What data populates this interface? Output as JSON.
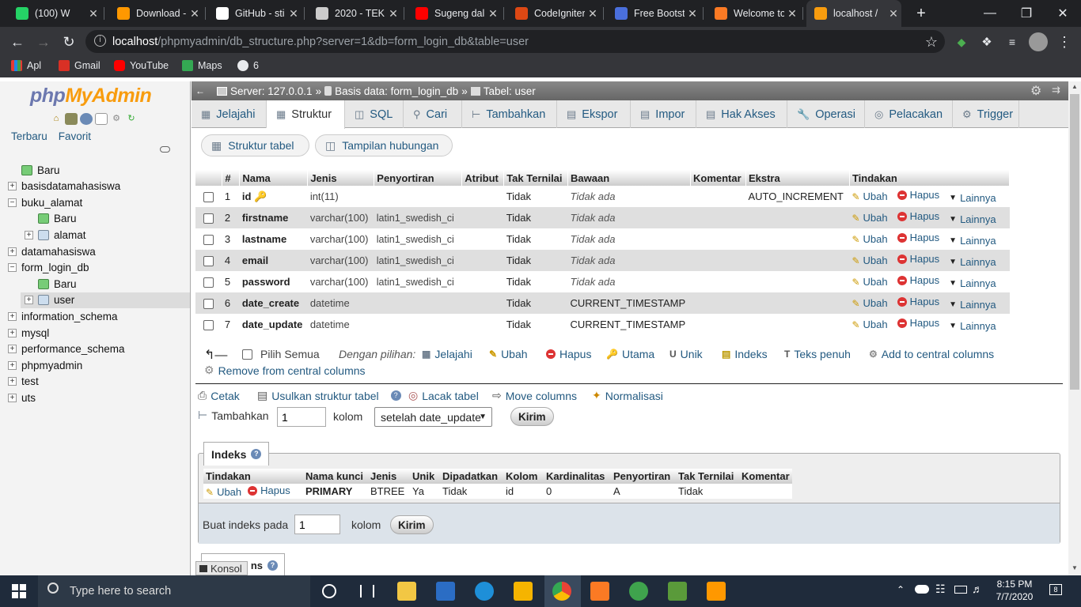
{
  "browser": {
    "tabs": [
      {
        "title": "(100) W",
        "fav": "whatsapp-icon",
        "color": "#25d366"
      },
      {
        "title": "Download -",
        "fav": "sublime-icon",
        "color": "#ff9800"
      },
      {
        "title": "GitHub - sti",
        "fav": "github-icon",
        "color": "#ffffff"
      },
      {
        "title": "2020 - TEK",
        "fav": "classroom-icon",
        "color": "#cccccc"
      },
      {
        "title": "Sugeng dal",
        "fav": "youtube-icon",
        "color": "#ff0000"
      },
      {
        "title": "CodeIgniter",
        "fav": "codeigniter-icon",
        "color": "#dd4814"
      },
      {
        "title": "Free Bootst",
        "fav": "bootstrap-icon",
        "color": "#4a6fdc"
      },
      {
        "title": "Welcome to",
        "fav": "xampp-icon",
        "color": "#fb7a24"
      },
      {
        "title": "localhost /",
        "fav": "phpmyadmin-icon",
        "color": "#f89c0e"
      }
    ],
    "url_host": "localhost",
    "url_path": "/phpmyadmin/db_structure.php?server=1&db=form_login_db&table=user",
    "bookmarks": [
      {
        "label": "Apl"
      },
      {
        "label": "Gmail"
      },
      {
        "label": "YouTube"
      },
      {
        "label": "Maps"
      },
      {
        "label": "6"
      }
    ]
  },
  "pma": {
    "logo_a": "php",
    "logo_b": "MyAdmin",
    "left_tabs": [
      "Terbaru",
      "Favorit"
    ],
    "tree": [
      {
        "label": "Baru",
        "level": 0,
        "kind": "new"
      },
      {
        "label": "basisdatamahasiswa",
        "level": 0,
        "kind": "db"
      },
      {
        "label": "buku_alamat",
        "level": 0,
        "kind": "db-open"
      },
      {
        "label": "Baru",
        "level": 1,
        "kind": "new"
      },
      {
        "label": "alamat",
        "level": 1,
        "kind": "table"
      },
      {
        "label": "datamahasiswa",
        "level": 0,
        "kind": "db"
      },
      {
        "label": "form_login_db",
        "level": 0,
        "kind": "db-open"
      },
      {
        "label": "Baru",
        "level": 1,
        "kind": "new"
      },
      {
        "label": "user",
        "level": 1,
        "kind": "table"
      },
      {
        "label": "information_schema",
        "level": 0,
        "kind": "db"
      },
      {
        "label": "mysql",
        "level": 0,
        "kind": "db"
      },
      {
        "label": "performance_schema",
        "level": 0,
        "kind": "db"
      },
      {
        "label": "phpmyadmin",
        "level": 0,
        "kind": "db"
      },
      {
        "label": "test",
        "level": 0,
        "kind": "db"
      },
      {
        "label": "uts",
        "level": 0,
        "kind": "db"
      }
    ],
    "breadcrumb": {
      "server": "Server: 127.0.0.1",
      "database": "Basis data: form_login_db",
      "table": "Tabel: user"
    },
    "nav_tabs": [
      "Jelajahi",
      "Struktur",
      "SQL",
      "Cari",
      "Tambahkan",
      "Ekspor",
      "Impor",
      "Hak Akses",
      "Operasi",
      "Pelacakan",
      "Trigger"
    ],
    "sub_tabs": [
      "Struktur tabel",
      "Tampilan hubungan"
    ],
    "structure": {
      "headers": [
        "",
        "#",
        "Nama",
        "Jenis",
        "Penyortiran",
        "Atribut",
        "Tak Ternilai",
        "Bawaan",
        "Komentar",
        "Ekstra",
        "Tindakan"
      ],
      "rows": [
        {
          "num": "1",
          "name": "id",
          "type": "int(11)",
          "collation": "",
          "attr": "",
          "null": "Tidak",
          "default": "Tidak ada",
          "comment": "",
          "extra": "AUTO_INCREMENT"
        },
        {
          "num": "2",
          "name": "firstname",
          "type": "varchar(100)",
          "collation": "latin1_swedish_ci",
          "attr": "",
          "null": "Tidak",
          "default": "Tidak ada",
          "comment": "",
          "extra": ""
        },
        {
          "num": "3",
          "name": "lastname",
          "type": "varchar(100)",
          "collation": "latin1_swedish_ci",
          "attr": "",
          "null": "Tidak",
          "default": "Tidak ada",
          "comment": "",
          "extra": ""
        },
        {
          "num": "4",
          "name": "email",
          "type": "varchar(100)",
          "collation": "latin1_swedish_ci",
          "attr": "",
          "null": "Tidak",
          "default": "Tidak ada",
          "comment": "",
          "extra": ""
        },
        {
          "num": "5",
          "name": "password",
          "type": "varchar(100)",
          "collation": "latin1_swedish_ci",
          "attr": "",
          "null": "Tidak",
          "default": "Tidak ada",
          "comment": "",
          "extra": ""
        },
        {
          "num": "6",
          "name": "date_create",
          "type": "datetime",
          "collation": "",
          "attr": "",
          "null": "Tidak",
          "default": "CURRENT_TIMESTAMP",
          "comment": "",
          "extra": ""
        },
        {
          "num": "7",
          "name": "date_update",
          "type": "datetime",
          "collation": "",
          "attr": "",
          "null": "Tidak",
          "default": "CURRENT_TIMESTAMP",
          "comment": "",
          "extra": ""
        }
      ],
      "row_actions": [
        "Ubah",
        "Hapus",
        "Lainnya"
      ]
    },
    "with_selected": {
      "check_all": "Pilih Semua",
      "label": "Dengan pilihan:",
      "actions": [
        "Jelajahi",
        "Ubah",
        "Hapus",
        "Utama",
        "Unik",
        "Indeks",
        "Teks penuh",
        "Add to central columns"
      ],
      "remove_central": "Remove from central columns"
    },
    "tools": [
      "Cetak",
      "Usulkan struktur tabel",
      "Lacak tabel",
      "Move columns",
      "Normalisasi"
    ],
    "add_column": {
      "label": "Tambahkan",
      "count": "1",
      "unit": "kolom",
      "position": "setelah date_update",
      "submit": "Kirim"
    },
    "indexes": {
      "legend": "Indeks",
      "headers": [
        "Tindakan",
        "Nama kunci",
        "Jenis",
        "Unik",
        "Dipadatkan",
        "Kolom",
        "Kardinalitas",
        "Penyortiran",
        "Tak Ternilai",
        "Komentar"
      ],
      "row": {
        "edit": "Ubah",
        "drop": "Hapus",
        "keyname": "PRIMARY",
        "type": "BTREE",
        "unique": "Ya",
        "packed": "Tidak",
        "column": "id",
        "cardinality": "0",
        "collation": "A",
        "null": "Tidak",
        "comment": ""
      },
      "create_label": "Buat indeks pada",
      "create_count": "1",
      "create_unit": "kolom",
      "create_submit": "Kirim"
    },
    "partial_legend": "ns",
    "console": "Konsol"
  },
  "taskbar": {
    "search_placeholder": "Type here to search",
    "time": "8:15 PM",
    "date": "7/7/2020",
    "notifications": "8"
  }
}
